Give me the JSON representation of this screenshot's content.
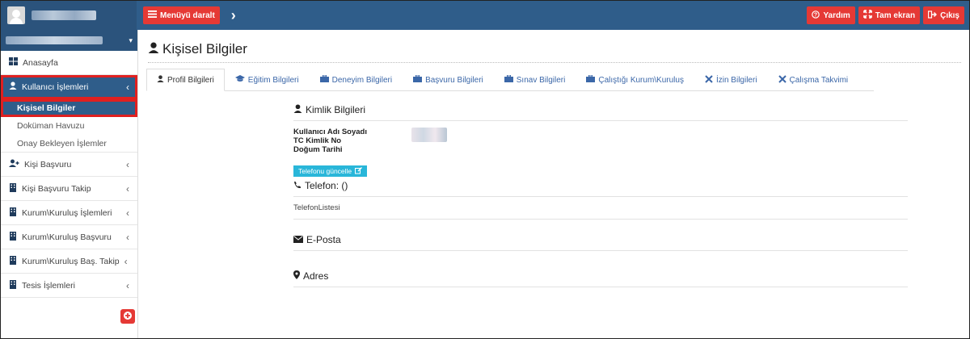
{
  "topbar": {
    "menu_label": "Menüyü daralt",
    "buttons": [
      {
        "label": "Yardım",
        "icon": "help-circle-icon"
      },
      {
        "label": "Tam ekran",
        "icon": "fullscreen-icon"
      },
      {
        "label": "Çıkış",
        "icon": "logout-icon"
      }
    ]
  },
  "sidebar": {
    "items": [
      {
        "label": "Anasayfa",
        "icon": "dashboard-icon"
      },
      {
        "label": "Kullanıcı İşlemleri",
        "icon": "user-icon"
      },
      {
        "label": "Kişi Başvuru",
        "icon": "user-plus-icon"
      },
      {
        "label": "Kişi Başvuru Takip",
        "icon": "building-icon"
      },
      {
        "label": "Kurum\\Kuruluş İşlemleri",
        "icon": "building-icon"
      },
      {
        "label": "Kurum\\Kuruluş Başvuru",
        "icon": "building-icon"
      },
      {
        "label": "Kurum\\Kuruluş Baş. Takip",
        "icon": "building-icon"
      },
      {
        "label": "Tesis İşlemleri",
        "icon": "building-icon"
      }
    ],
    "subitems": [
      {
        "label": "Kişisel Bilgiler"
      },
      {
        "label": "Doküman Havuzu"
      },
      {
        "label": "Onay Bekleyen İşlemler"
      }
    ]
  },
  "page": {
    "title": "Kişisel Bilgiler",
    "tabs": [
      {
        "label": "Profil Bilgileri"
      },
      {
        "label": "Eğitim Bilgileri"
      },
      {
        "label": "Deneyim Bilgileri"
      },
      {
        "label": "Başvuru Bilgileri"
      },
      {
        "label": "Sınav Bilgileri"
      },
      {
        "label": "Çalıştığı Kurum\\Kuruluş"
      },
      {
        "label": "İzin Bilgileri"
      },
      {
        "label": "Çalışma Takvimi"
      }
    ]
  },
  "profile": {
    "identity_title": "Kimlik Bilgileri",
    "fields": [
      "Kullanıcı Adı Soyadı",
      "TC Kimlik No",
      "Doğum Tarihi"
    ],
    "update_phone_label": "Telefonu güncelle",
    "phone_title": "Telefon: ()",
    "phone_list": "TelefonListesi",
    "email_title": "E-Posta",
    "address_title": "Adres"
  },
  "colors": {
    "primary": "#2f5d8a",
    "danger": "#e53935",
    "teal": "#29b6d9",
    "highlight": "#e02020"
  }
}
